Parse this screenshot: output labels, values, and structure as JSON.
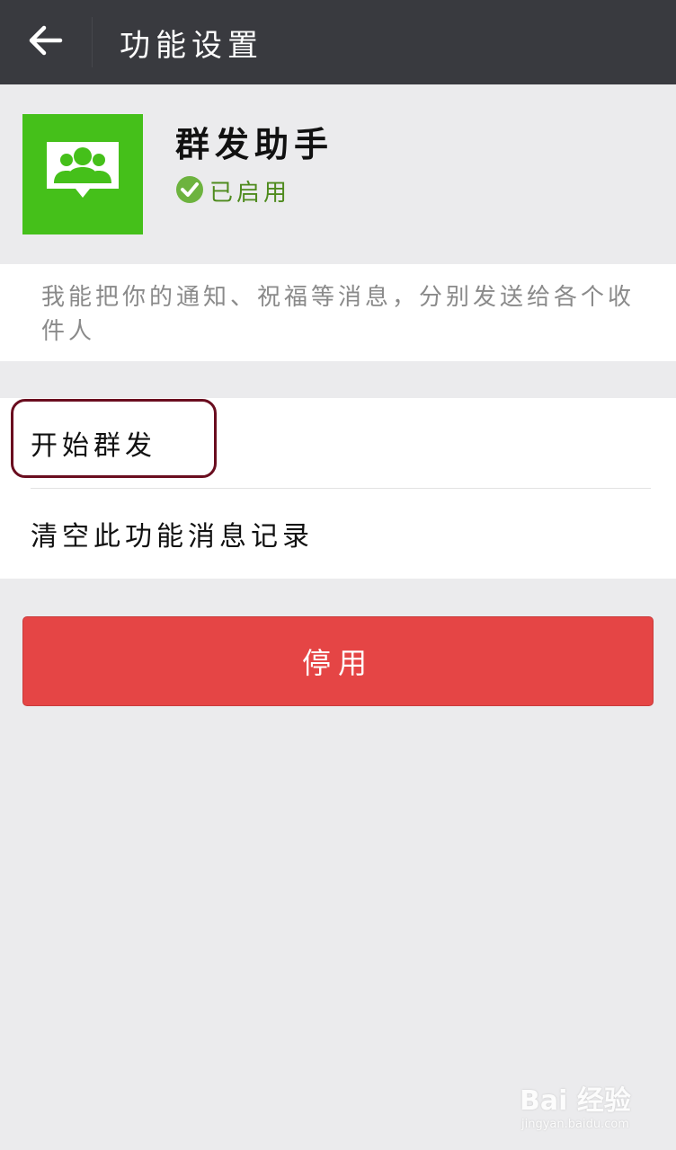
{
  "topbar": {
    "back_icon": "arrow-left-icon",
    "title": "功能设置"
  },
  "app": {
    "logo_icon": "group-chat-icon",
    "logo_color": "#45c01a",
    "name": "群发助手",
    "status_icon": "check-circle-icon",
    "status_text": "已启用",
    "status_color": "#4f8b1e"
  },
  "description": "我能把你的通知、祝福等消息，分别发送给各个收件人",
  "menu": {
    "items": [
      {
        "label": "开始群发"
      },
      {
        "label": "清空此功能消息记录"
      }
    ]
  },
  "disable_button": {
    "label": "停用",
    "color": "#e54545"
  },
  "watermark": {
    "main": "Bai 经验",
    "sub": "jingyan.baidu.com"
  }
}
